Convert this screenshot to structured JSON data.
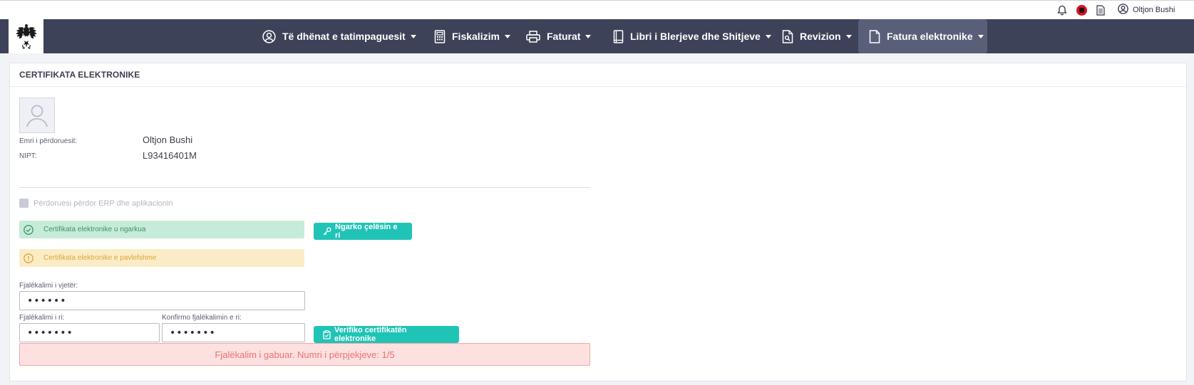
{
  "topbar": {
    "user_name": "Oltjon Bushi",
    "icons": [
      "bell-icon",
      "albania-flag-icon",
      "document-icon",
      "user-circle-icon"
    ]
  },
  "nav": {
    "logo": "albanian-eagle-logo",
    "items": [
      {
        "label": "Të dhënat e tatimpaguesit",
        "icon": "user-circle-icon"
      },
      {
        "label": "Fiskalizim",
        "icon": "calculator-icon"
      },
      {
        "label": "Faturat",
        "icon": "printer-icon"
      },
      {
        "label": "Libri i Blerjeve dhe Shitjeve",
        "icon": "book-icon"
      },
      {
        "label": "Revizion",
        "icon": "audit-document-icon"
      },
      {
        "label": "Fatura elektronike",
        "icon": "e-invoice-icon",
        "active": true
      }
    ]
  },
  "page": {
    "title": "CERTIFIKATA ELEKTRONIKE",
    "user": {
      "name_label": "Emri i përdoruesit:",
      "name_value": "Oltjon Bushi",
      "nipt_label": "NIPT:",
      "nipt_value": "L93416401M"
    },
    "erp_checkbox_label": "Përdoruesi përdor ERP dhe aplikacionin",
    "alerts": {
      "success": "Certifikata elektronike u ngarkua",
      "warning": "Certifikata elektronike e pavlefshme"
    },
    "buttons": {
      "upload_key": "Ngarko çelësin e ri",
      "verify": "Verifiko certifikatën elektronike"
    },
    "fields": {
      "old_password_label": "Fjalëkalimi i vjetër:",
      "old_password_value": "••••••",
      "new_password_label": "Fjalëkalimi i ri:",
      "new_password_value": "•••••••",
      "confirm_password_label": "Konfirmo fjalëkalimin e ri:",
      "confirm_password_value": "•••••••"
    },
    "error": "Fjalëkalim i gabuar. Numri i përpjekjeve: 1/5"
  },
  "colors": {
    "navbar": "#3e4258",
    "nav_active": "#5a5f79",
    "teal_button": "#20c4b6",
    "success_bg": "#c7ebd9",
    "warning_bg": "#fbecc6",
    "error_bg": "#fde0e0"
  }
}
